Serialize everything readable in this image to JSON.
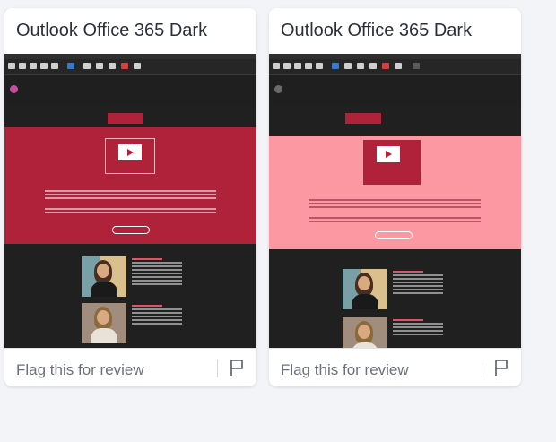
{
  "cards": [
    {
      "title": "Outlook Office 365 Dark",
      "flag_label": "Flag this for review",
      "hero_color": "#b0213a",
      "flag_icon": "flag-icon"
    },
    {
      "title": "Outlook Office 365 Dark",
      "flag_label": "Flag this for review",
      "hero_color": "#fb98a2",
      "flag_icon": "flag-icon"
    }
  ],
  "colors": {
    "page_background": "#f3f4f7",
    "card_background": "#ffffff",
    "outlook_dark": "#1e1e1e",
    "brand_red": "#b0213a",
    "hero_pink": "#fb98a2"
  }
}
